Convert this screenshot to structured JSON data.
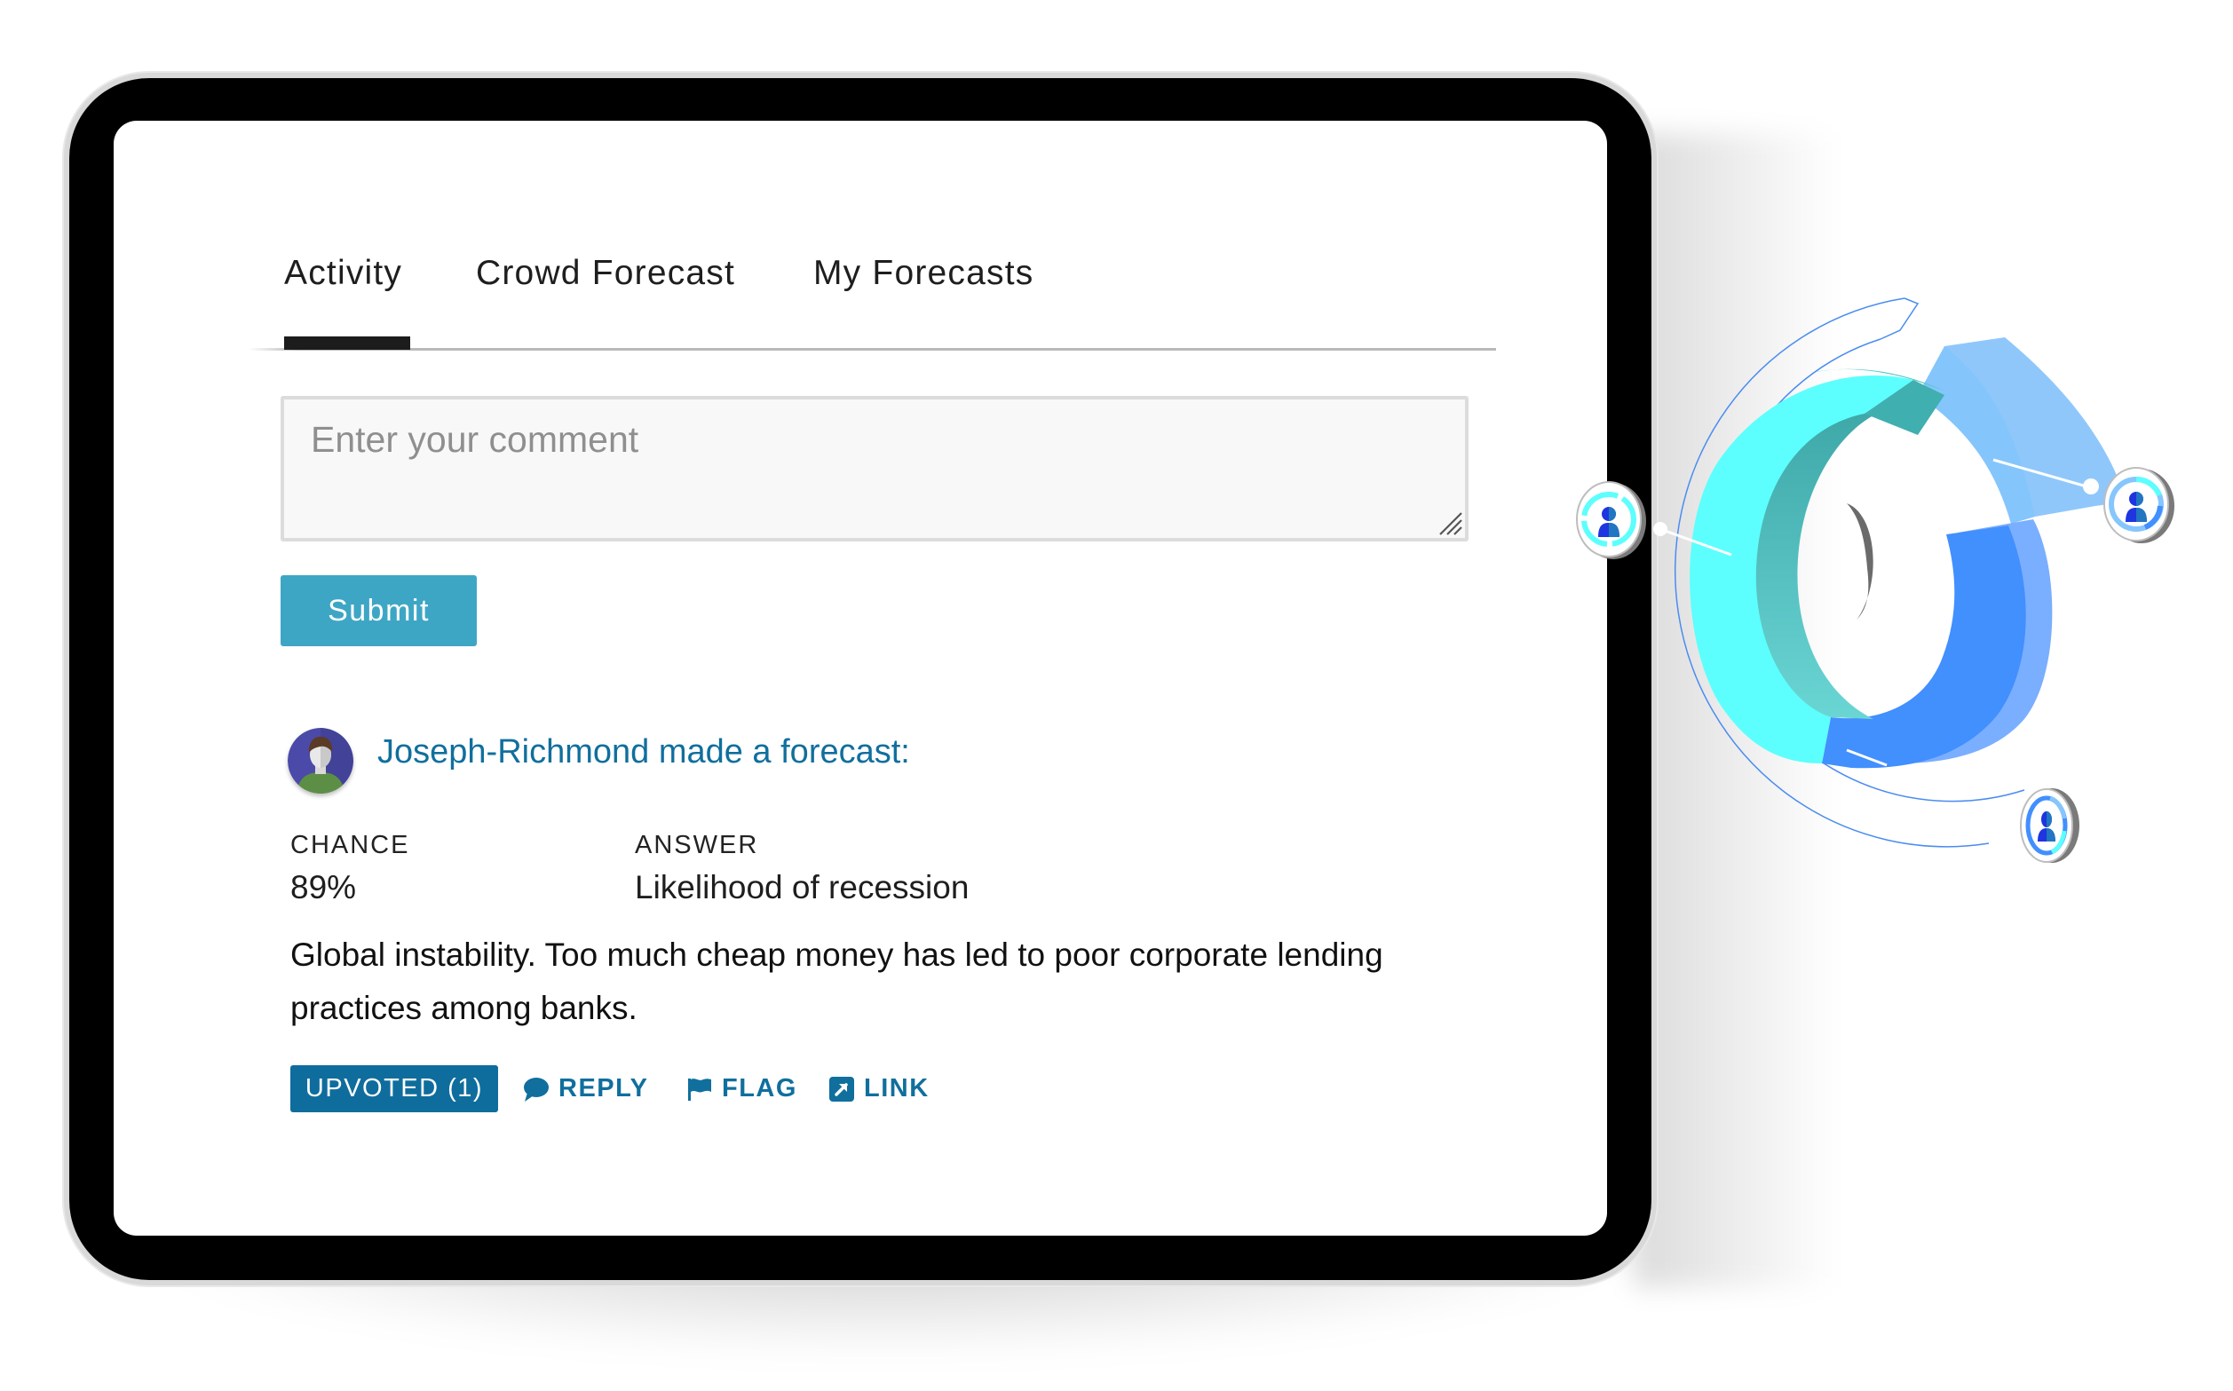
{
  "tabs": [
    {
      "label": "Activity",
      "active": true
    },
    {
      "label": "Crowd Forecast",
      "active": false
    },
    {
      "label": "My Forecasts",
      "active": false
    }
  ],
  "comment_form": {
    "placeholder": "Enter your comment",
    "value": "",
    "submit_label": "Submit"
  },
  "feed": {
    "item": {
      "user": "Joseph-Richmond",
      "headline": "Joseph-Richmond made a forecast:",
      "chance_label": "CHANCE",
      "chance_value": "89%",
      "answer_label": "ANSWER",
      "answer_value": "Likelihood of recession",
      "text": "Global instability. Too much cheap money has led to poor corporate lending practices among banks.",
      "actions": {
        "upvoted_label": "UPVOTED (1)",
        "reply_label": "REPLY",
        "flag_label": "FLAG",
        "link_label": "LINK"
      },
      "icons": {
        "reply": "speech-bubble-icon",
        "flag": "flag-icon",
        "link": "external-link-icon"
      }
    }
  },
  "illustration": {
    "type": "decorative-donut-chart",
    "badges": [
      "user-badge-left",
      "user-badge-right",
      "user-badge-bottom"
    ],
    "colors": {
      "cyan": "#5cfffd",
      "teal": "#40afb0",
      "blue": "#428ffe",
      "light_blue": "#86c6fd",
      "pale_blue": "#7aaefe",
      "ring_line": "#4a8cf0"
    }
  },
  "colors": {
    "accent": "#106f9d",
    "submit": "#3ea6c5",
    "upvoted_bg": "#0f6d9d",
    "text": "#1e1e1e",
    "placeholder": "#8f8f8f"
  }
}
